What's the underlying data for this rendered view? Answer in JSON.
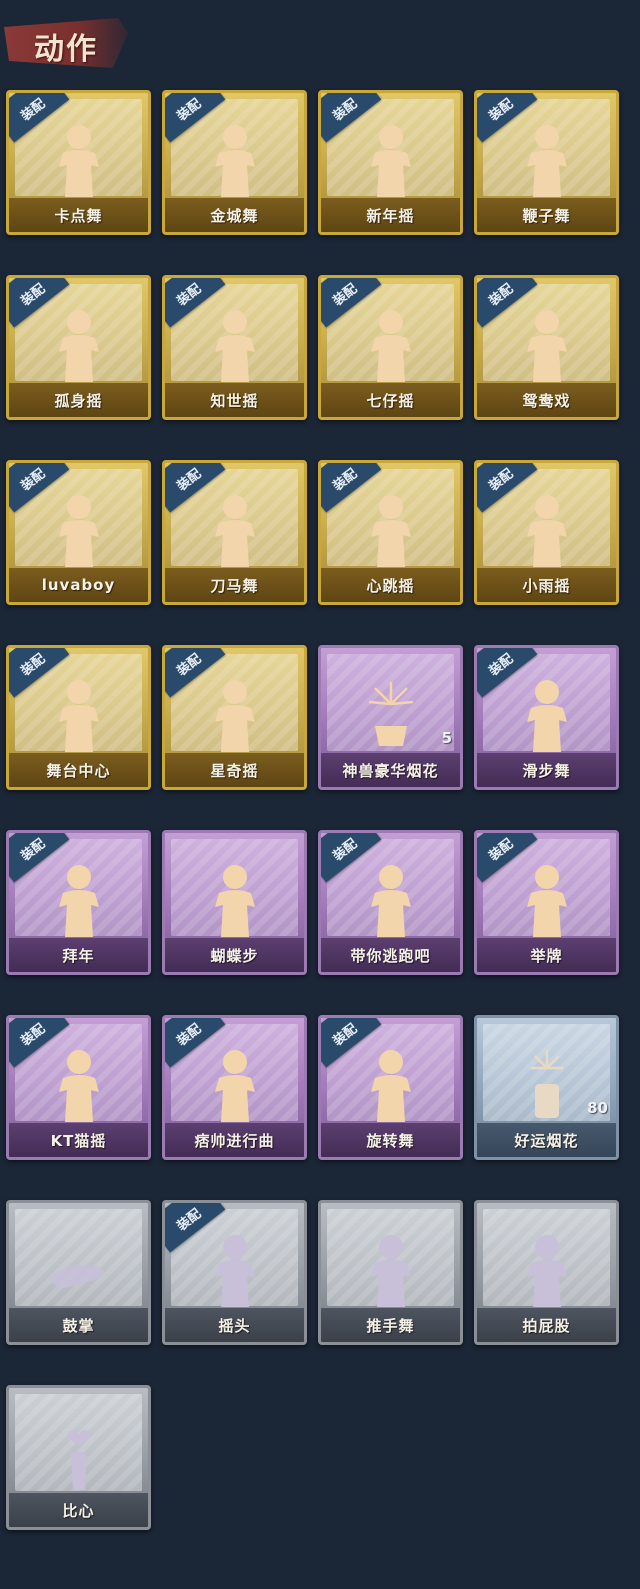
{
  "header": {
    "title": "动作"
  },
  "colors": {
    "gold": "#cbb054",
    "purple": "#a67ebd",
    "blue": "#95aabf",
    "gray": "#9ba1a8",
    "badge": "#2a4a6c",
    "background": "#1b2636"
  },
  "items": [
    {
      "label": "卡点舞",
      "tier": "gold",
      "equipped": true,
      "badge": "装配",
      "icon": "dance-pose-icon"
    },
    {
      "label": "金城舞",
      "tier": "gold",
      "equipped": true,
      "badge": "装配",
      "icon": "dance-pose-icon"
    },
    {
      "label": "新年摇",
      "tier": "gold",
      "equipped": true,
      "badge": "装配",
      "icon": "dance-pose-icon"
    },
    {
      "label": "鞭子舞",
      "tier": "gold",
      "equipped": true,
      "badge": "装配",
      "icon": "dance-pose-icon"
    },
    {
      "label": "孤身摇",
      "tier": "gold",
      "equipped": true,
      "badge": "装配",
      "icon": "dance-pose-icon"
    },
    {
      "label": "知世摇",
      "tier": "gold",
      "equipped": true,
      "badge": "装配",
      "icon": "dance-pose-icon"
    },
    {
      "label": "七仔摇",
      "tier": "gold",
      "equipped": true,
      "badge": "装配",
      "icon": "dance-pose-icon"
    },
    {
      "label": "鸳鸯戏",
      "tier": "gold",
      "equipped": true,
      "badge": "装配",
      "icon": "dance-pose-icon"
    },
    {
      "label": "luvaboy",
      "tier": "gold",
      "equipped": true,
      "badge": "装配",
      "icon": "dance-pose-icon"
    },
    {
      "label": "刀马舞",
      "tier": "gold",
      "equipped": true,
      "badge": "装配",
      "icon": "dance-pose-icon"
    },
    {
      "label": "心跳摇",
      "tier": "gold",
      "equipped": true,
      "badge": "装配",
      "icon": "dance-pose-icon"
    },
    {
      "label": "小雨摇",
      "tier": "gold",
      "equipped": true,
      "badge": "装配",
      "icon": "dance-pose-icon"
    },
    {
      "label": "舞台中心",
      "tier": "gold",
      "equipped": true,
      "badge": "装配",
      "icon": "dance-pose-icon"
    },
    {
      "label": "星奇摇",
      "tier": "gold",
      "equipped": true,
      "badge": "装配",
      "icon": "dance-pose-icon"
    },
    {
      "label": "神兽豪华烟花",
      "tier": "purple",
      "equipped": false,
      "badge": "",
      "icon": "fireworks-icon",
      "count": "5"
    },
    {
      "label": "滑步舞",
      "tier": "purple",
      "equipped": true,
      "badge": "装配",
      "icon": "dance-pose-icon"
    },
    {
      "label": "拜年",
      "tier": "purple",
      "equipped": true,
      "badge": "装配",
      "icon": "bow-pose-icon"
    },
    {
      "label": "蝴蝶步",
      "tier": "purple",
      "equipped": false,
      "badge": "",
      "icon": "dance-pose-icon"
    },
    {
      "label": "带你逃跑吧",
      "tier": "purple",
      "equipped": true,
      "badge": "装配",
      "icon": "dance-pose-icon"
    },
    {
      "label": "举牌",
      "tier": "purple",
      "equipped": true,
      "badge": "装配",
      "icon": "sign-pose-icon"
    },
    {
      "label": "KT猫摇",
      "tier": "purple",
      "equipped": true,
      "badge": "装配",
      "icon": "dance-pose-icon"
    },
    {
      "label": "痞帅进行曲",
      "tier": "purple",
      "equipped": true,
      "badge": "装配",
      "icon": "dance-pose-icon"
    },
    {
      "label": "旋转舞",
      "tier": "purple",
      "equipped": true,
      "badge": "装配",
      "icon": "spin-pose-icon"
    },
    {
      "label": "好运烟花",
      "tier": "blue",
      "equipped": false,
      "badge": "",
      "icon": "firework-can-icon",
      "count": "80"
    },
    {
      "label": "鼓掌",
      "tier": "gray",
      "equipped": false,
      "badge": "",
      "icon": "clap-icon"
    },
    {
      "label": "摇头",
      "tier": "gray",
      "equipped": true,
      "badge": "装配",
      "icon": "dance-pose-icon"
    },
    {
      "label": "推手舞",
      "tier": "gray",
      "equipped": false,
      "badge": "",
      "icon": "dance-pose-icon"
    },
    {
      "label": "拍屁股",
      "tier": "gray",
      "equipped": false,
      "badge": "",
      "icon": "dance-pose-icon"
    },
    {
      "label": "比心",
      "tier": "gray",
      "equipped": false,
      "badge": "",
      "icon": "heart-hand-icon"
    }
  ]
}
